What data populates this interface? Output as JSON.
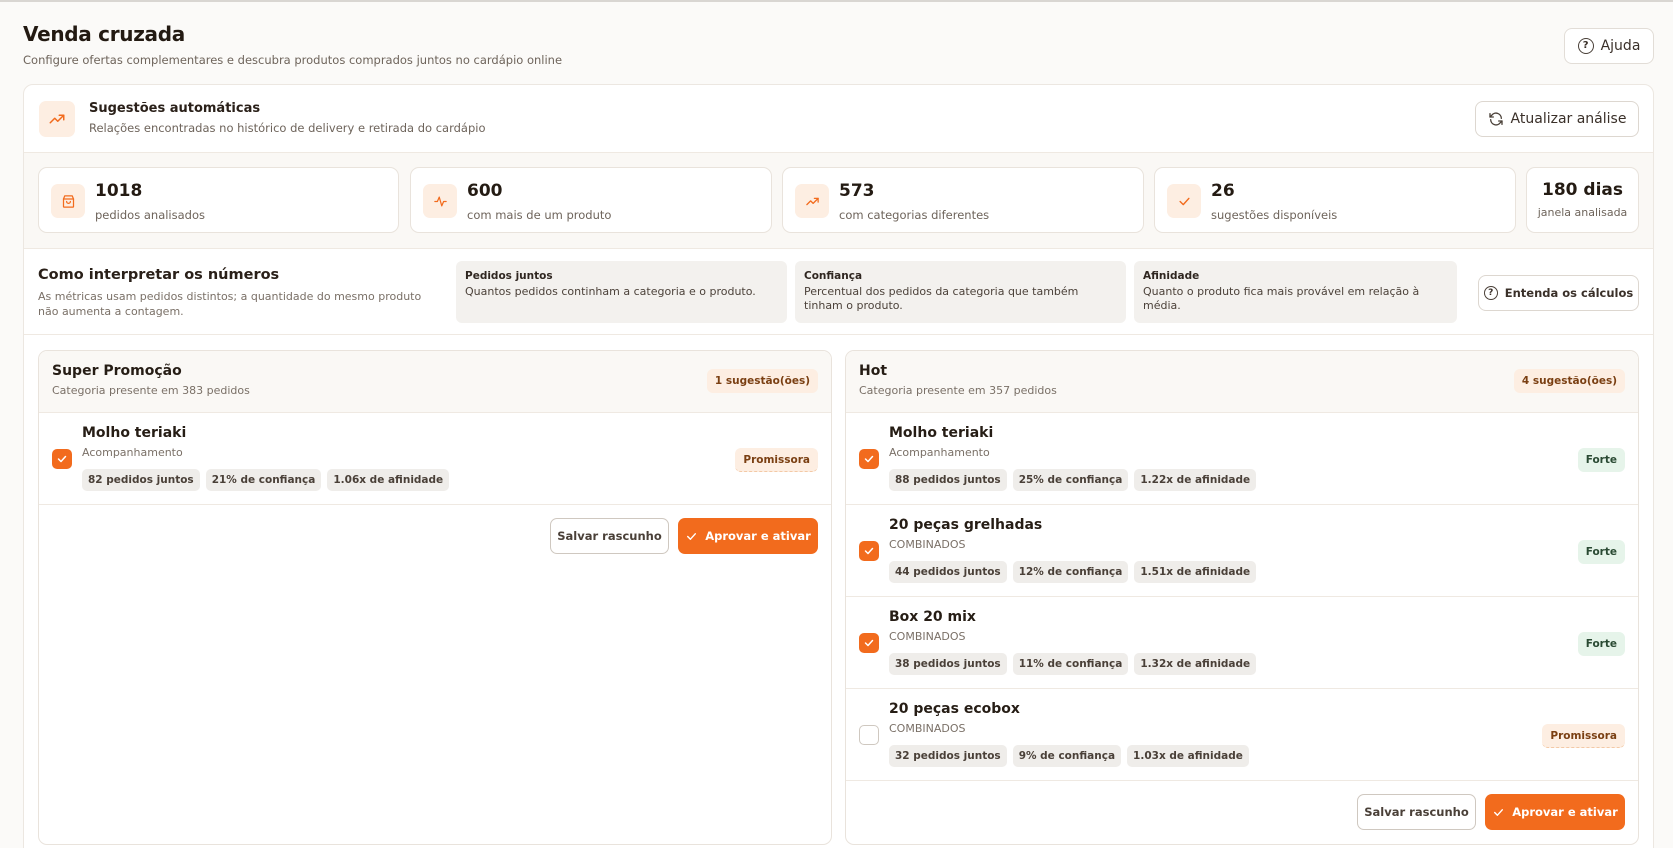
{
  "header": {
    "title": "Venda cruzada",
    "subtitle": "Configure ofertas complementares e descubra produtos comprados juntos no cardápio online",
    "help_label": "Ajuda"
  },
  "suggestions": {
    "title": "Sugestões automáticas",
    "subtitle": "Relações encontradas no histórico de delivery e retirada do cardápio",
    "refresh_label": "Atualizar análise",
    "icon": "trending-up-icon"
  },
  "stats": [
    {
      "value": "1018",
      "label": "pedidos analisados",
      "icon": "shopping-bag-icon"
    },
    {
      "value": "600",
      "label": "com mais de um produto",
      "icon": "activity-icon"
    },
    {
      "value": "573",
      "label": "com categorias diferentes",
      "icon": "trending-up-icon"
    },
    {
      "value": "26",
      "label": "sugestões disponíveis",
      "icon": "check-icon"
    },
    {
      "value": "180 dias",
      "label": "janela analisada"
    }
  ],
  "interpret": {
    "title": "Como interpretar os números",
    "description": "As métricas usam pedidos distintos; a quantidade do mesmo produto não aumenta a contagem.",
    "metrics": [
      {
        "name": "Pedidos juntos",
        "description": "Quantos pedidos continham a categoria e o produto."
      },
      {
        "name": "Confiança",
        "description": "Percentual dos pedidos da categoria que também tinham o produto."
      },
      {
        "name": "Afinidade",
        "description": "Quanto o produto fica mais provável em relação à média."
      }
    ],
    "calc_label": "Entenda os cálculos"
  },
  "columns": [
    {
      "title": "Super Promoção",
      "subtitle": "Categoria presente em 383 pedidos",
      "badge": "1 sugestão(ões)",
      "items": [
        {
          "name": "Molho teriaki",
          "category": "Acompanhamento",
          "checked": true,
          "chips": [
            "82 pedidos juntos",
            "21% de confiança",
            "1.06x de afinidade"
          ],
          "strength": "Promissora"
        }
      ],
      "draft_label": "Salvar rascunho",
      "approve_label": "Aprovar e ativar"
    },
    {
      "title": "Hot",
      "subtitle": "Categoria presente em 357 pedidos",
      "badge": "4 sugestão(ões)",
      "items": [
        {
          "name": "Molho teriaki",
          "category": "Acompanhamento",
          "checked": true,
          "chips": [
            "88 pedidos juntos",
            "25% de confiança",
            "1.22x de afinidade"
          ],
          "strength": "Forte"
        },
        {
          "name": "20 peças grelhadas",
          "category": "COMBINADOS",
          "checked": true,
          "chips": [
            "44 pedidos juntos",
            "12% de confiança",
            "1.51x de afinidade"
          ],
          "strength": "Forte"
        },
        {
          "name": "Box 20 mix",
          "category": "COMBINADOS",
          "checked": true,
          "chips": [
            "38 pedidos juntos",
            "11% de confiança",
            "1.32x de afinidade"
          ],
          "strength": "Forte"
        },
        {
          "name": "20 peças ecobox",
          "category": "COMBINADOS",
          "checked": false,
          "chips": [
            "32 pedidos juntos",
            "9% de confiança",
            "1.03x de afinidade"
          ],
          "strength": "Promissora"
        }
      ],
      "draft_label": "Salvar rascunho",
      "approve_label": "Aprovar e ativar"
    }
  ],
  "colors": {
    "accent": "#f26b1d",
    "accent_soft": "#fdeee2",
    "strong_bg": "#e6f4ea"
  }
}
